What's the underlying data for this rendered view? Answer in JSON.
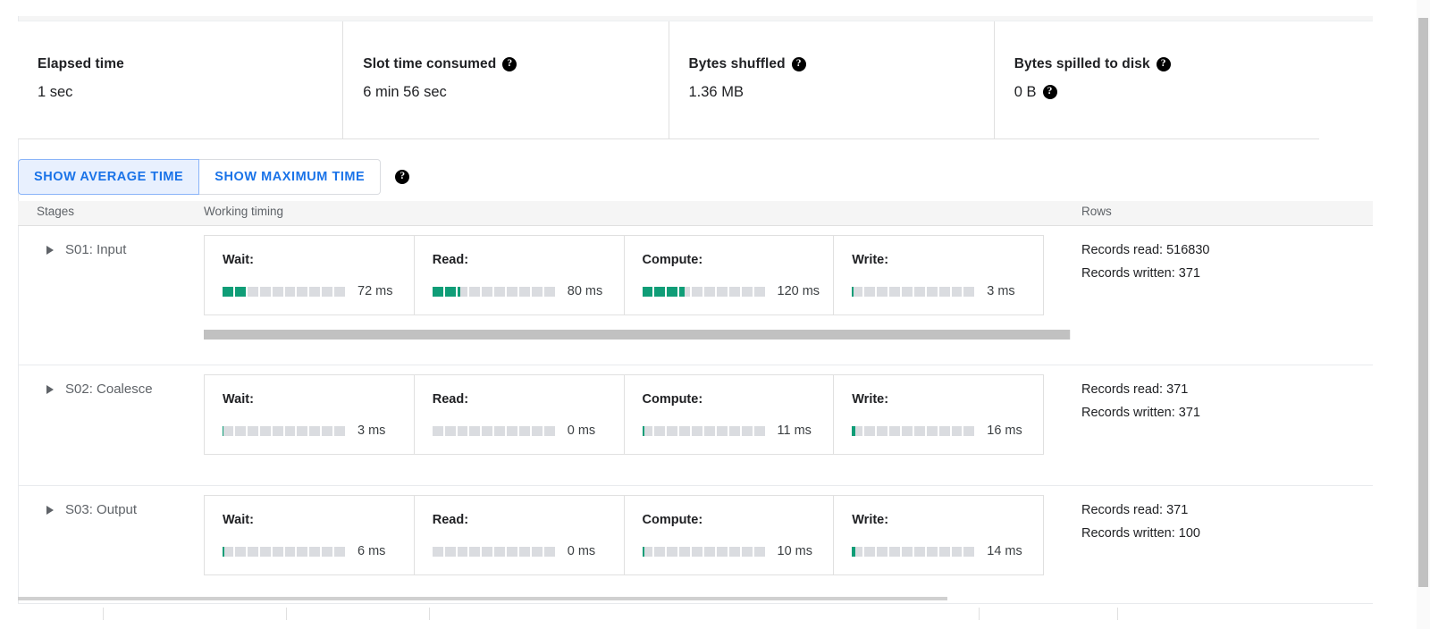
{
  "summary": {
    "stats": [
      {
        "label": "Elapsed time",
        "value": "1 sec",
        "label_help": false,
        "value_help": false
      },
      {
        "label": "Slot time consumed",
        "value": "6 min 56 sec",
        "label_help": true,
        "value_help": false
      },
      {
        "label": "Bytes shuffled",
        "value": "1.36 MB",
        "label_help": true,
        "value_help": false
      },
      {
        "label": "Bytes spilled to disk",
        "value": "0 B",
        "label_help": true,
        "value_help": true
      }
    ]
  },
  "toggle": {
    "average_label": "SHOW AVERAGE TIME",
    "maximum_label": "SHOW MAXIMUM TIME",
    "active": "average",
    "help_glyph": "?"
  },
  "table": {
    "headers": {
      "stages": "Stages",
      "timing": "Working timing",
      "rows": "Rows"
    },
    "phase_labels": {
      "wait": "Wait:",
      "read": "Read:",
      "compute": "Compute:",
      "write": "Write:"
    },
    "segment_count": 10,
    "rows": [
      {
        "stage": "S01: Input",
        "phases": [
          {
            "name": "Wait:",
            "ms": "72 ms",
            "fill_ratio": 0.2
          },
          {
            "name": "Read:",
            "ms": "80 ms",
            "fill_ratio": 0.225
          },
          {
            "name": "Compute:",
            "ms": "120 ms",
            "fill_ratio": 0.345
          },
          {
            "name": "Write:",
            "ms": "3 ms",
            "fill_ratio": 0.012
          }
        ],
        "records_read": "Records read: 516830",
        "records_written": "Records written: 371",
        "has_scrollbar": true
      },
      {
        "stage": "S02: Coalesce",
        "phases": [
          {
            "name": "Wait:",
            "ms": "3 ms",
            "fill_ratio": 0.004
          },
          {
            "name": "Read:",
            "ms": "0 ms",
            "fill_ratio": 0.0
          },
          {
            "name": "Compute:",
            "ms": "11 ms",
            "fill_ratio": 0.022
          },
          {
            "name": "Write:",
            "ms": "16 ms",
            "fill_ratio": 0.03
          }
        ],
        "records_read": "Records read: 371",
        "records_written": "Records written: 371",
        "has_scrollbar": false
      },
      {
        "stage": "S03: Output",
        "phases": [
          {
            "name": "Wait:",
            "ms": "6 ms",
            "fill_ratio": 0.014
          },
          {
            "name": "Read:",
            "ms": "0 ms",
            "fill_ratio": 0.0
          },
          {
            "name": "Compute:",
            "ms": "10 ms",
            "fill_ratio": 0.02
          },
          {
            "name": "Write:",
            "ms": "14 ms",
            "fill_ratio": 0.028
          }
        ],
        "records_read": "Records read: 371",
        "records_written": "Records written: 100",
        "has_scrollbar": false
      }
    ]
  },
  "colors": {
    "accent_blue": "#1a73e8",
    "bar_green": "#0f9d77",
    "bar_track": "#dadce0",
    "border": "#e0e0e0"
  }
}
